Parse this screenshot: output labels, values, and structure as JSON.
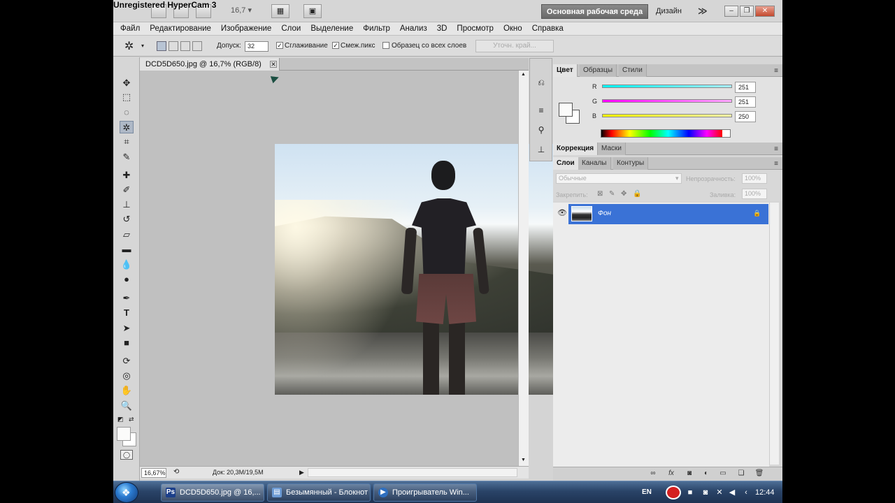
{
  "watermark": "Unregistered HyperCam 3",
  "appbar": {
    "zoom_level": "16,7",
    "workspace": "Основная рабочая среда",
    "design": "Дизайн",
    "more": "≫"
  },
  "menu": [
    "Файл",
    "Редактирование",
    "Изображение",
    "Слои",
    "Выделение",
    "Фильтр",
    "Анализ",
    "3D",
    "Просмотр",
    "Окно",
    "Справка"
  ],
  "options": {
    "tolerance_label": "Допуск:",
    "tolerance_value": "32",
    "antialias_label": "Сглаживание",
    "contiguous_label": "Смеж.пикс",
    "sample_all_label": "Образец со всех слоев",
    "refine_edge": "Уточн. край..."
  },
  "document": {
    "tab_title": "DCD5D650.jpg @ 16,7% (RGB/8)",
    "zoom": "16,67%",
    "doc_info": "Док: 20,3M/19,5M"
  },
  "color_panel": {
    "tabs": [
      "Цвет",
      "Образцы",
      "Стили"
    ],
    "r_label": "R",
    "g_label": "G",
    "b_label": "B",
    "r": "251",
    "g": "251",
    "b": "250",
    "fg_color": "#fbfbfa"
  },
  "adjust_panel": {
    "tabs": [
      "Коррекция",
      "Маски"
    ]
  },
  "layers_panel": {
    "tabs": [
      "Слои",
      "Каналы",
      "Контуры"
    ],
    "blend_mode": "Обычные",
    "opacity_label": "Непрозрачность:",
    "opacity": "100%",
    "lock_label": "Закрепить:",
    "fill_label": "Заливка:",
    "fill": "100%",
    "layer_name": "Фон"
  },
  "taskbar": {
    "items": [
      "DCD5D650.jpg @ 16,...",
      "Безымянный - Блокнот",
      "Проигрыватель Win..."
    ],
    "lang": "EN",
    "time": "12:44"
  },
  "colors": {
    "accent": "#3a72d6",
    "taskbar": "#2a4468"
  }
}
